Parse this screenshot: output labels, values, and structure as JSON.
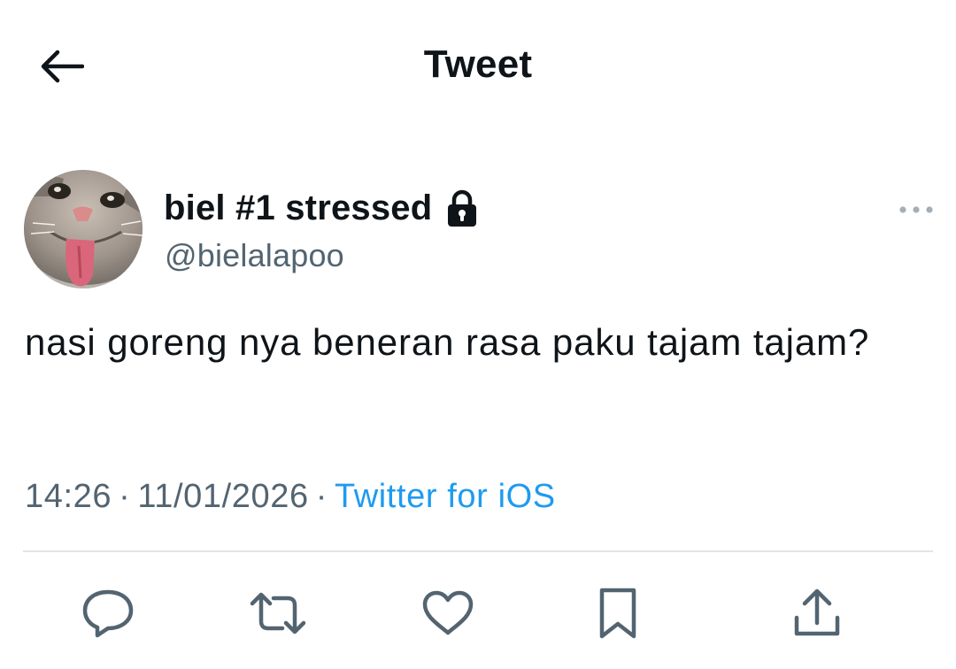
{
  "header": {
    "title": "Tweet",
    "back_icon": "arrow-left-icon"
  },
  "tweet": {
    "author": {
      "display_name": "biel #1 stressed",
      "handle": "@bielalapoo",
      "protected_icon": "lock-icon",
      "avatar_description": "cat-with-tongue-out avatar"
    },
    "text": "nasi goreng nya beneran rasa paku tajam tajam?",
    "time": "14:26",
    "date": "11/01/2026",
    "separator": "·",
    "source": "Twitter for iOS",
    "more_icon": "more-horizontal-icon"
  },
  "actions": [
    {
      "icon": "reply-icon"
    },
    {
      "icon": "retweet-icon"
    },
    {
      "icon": "like-icon"
    },
    {
      "icon": "bookmark-icon"
    },
    {
      "icon": "share-icon"
    }
  ],
  "colors": {
    "text_primary": "#0f1419",
    "text_secondary": "#536471",
    "link": "#1d9bf0",
    "divider": "#e1e6ea"
  }
}
